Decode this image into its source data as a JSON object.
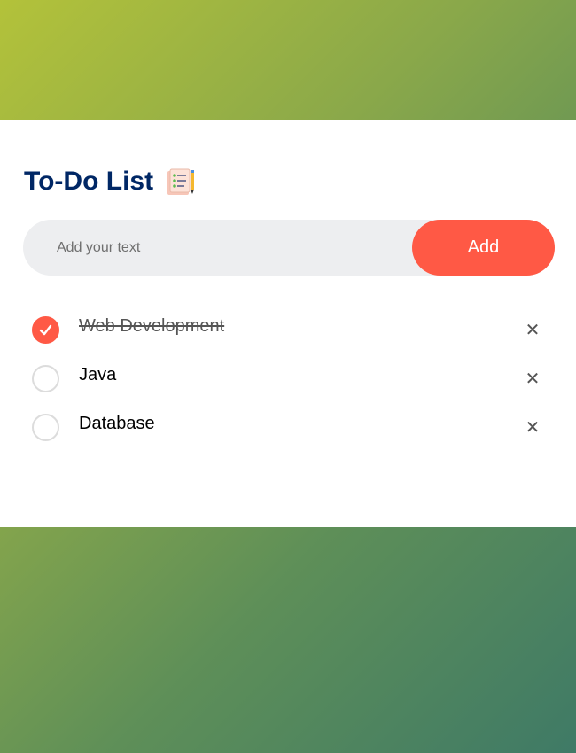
{
  "app": {
    "title": "To-Do List",
    "title_icon": "notepad-checklist-icon"
  },
  "input": {
    "placeholder": "Add your text",
    "value": ""
  },
  "add_button": {
    "label": "Add"
  },
  "tasks": [
    {
      "text": "Web Development",
      "checked": true
    },
    {
      "text": "Java",
      "checked": false
    },
    {
      "text": "Database",
      "checked": false
    }
  ],
  "icons": {
    "check": "check-icon",
    "delete": "close-icon",
    "delete_glyph": "✕"
  },
  "colors": {
    "accent": "#ff5945",
    "title": "#002765",
    "input_bg": "#edeef0",
    "gradient_start": "#b3c23a",
    "gradient_end": "#3f7a66"
  }
}
